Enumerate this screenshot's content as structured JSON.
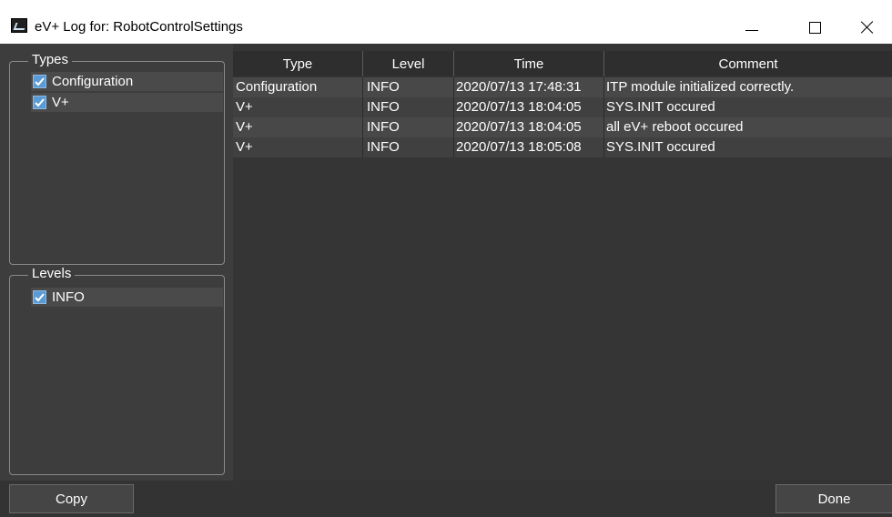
{
  "window": {
    "title": "eV+ Log for: RobotControlSettings"
  },
  "filters": {
    "types": {
      "legend": "Types",
      "items": [
        {
          "label": "Configuration",
          "checked": true
        },
        {
          "label": "V+",
          "checked": true
        }
      ]
    },
    "levels": {
      "legend": "Levels",
      "items": [
        {
          "label": "INFO",
          "checked": true
        }
      ]
    }
  },
  "table": {
    "columns": [
      "Type",
      "Level",
      "Time",
      "Comment"
    ],
    "rows": [
      [
        "Configuration",
        "INFO",
        "2020/07/13 17:48:31",
        "ITP module initialized correctly."
      ],
      [
        "V+",
        "INFO",
        "2020/07/13 18:04:05",
        "SYS.INIT occured"
      ],
      [
        "V+",
        "INFO",
        "2020/07/13 18:04:05",
        "all eV+ reboot occured"
      ],
      [
        "V+",
        "INFO",
        "2020/07/13 18:05:08",
        "SYS.INIT occured"
      ]
    ]
  },
  "buttons": {
    "copy_label": "Copy",
    "done_label": "Done"
  },
  "colors": {
    "checkbox_accent": "#5b9bd5",
    "background": "#333333"
  }
}
